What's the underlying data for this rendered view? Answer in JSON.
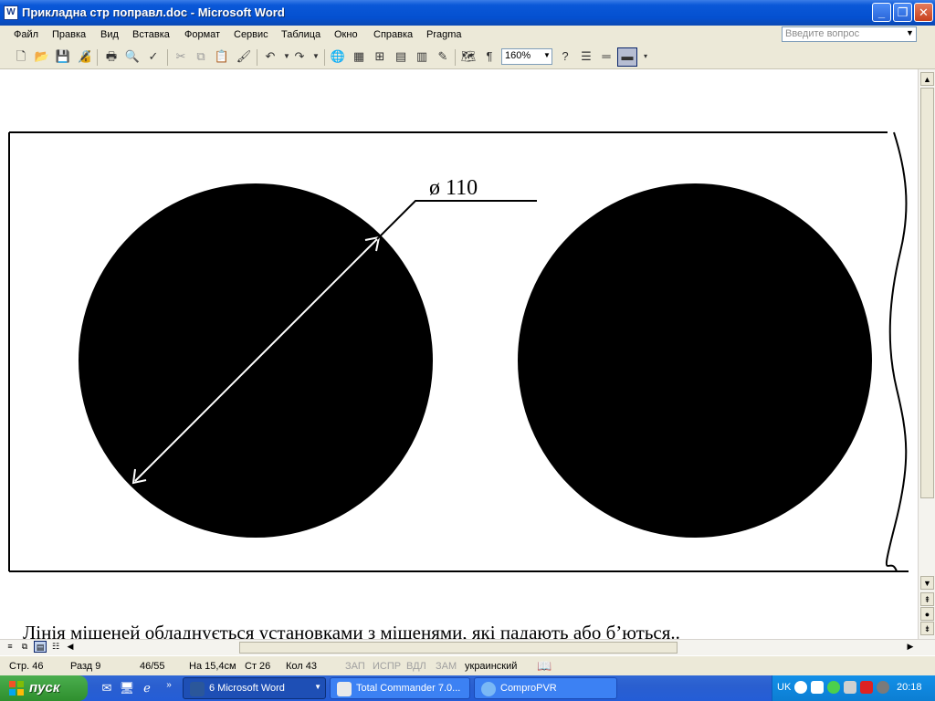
{
  "window": {
    "title": "Прикладна стр поправл.doc - Microsoft Word",
    "app_icon_label": "W"
  },
  "menu": [
    "Файл",
    "Правка",
    "Вид",
    "Вставка",
    "Формат",
    "Сервис",
    "Таблица",
    "Окно",
    "Справка",
    "Pragma"
  ],
  "help_box": {
    "placeholder": "Введите вопрос"
  },
  "toolbar": {
    "zoom": "160%"
  },
  "drawing": {
    "diameter_label": "ø 110"
  },
  "document": {
    "text": "Лінія мішеней обладнується установками з мішенями, які падають або б’ються.."
  },
  "statusbar": {
    "page": "Стр. 46",
    "section": "Разд 9",
    "pages": "46/55",
    "at": "На 15,4см",
    "line": "Ст 26",
    "col": "Кол 43",
    "rec": "ЗАП",
    "trk": "ИСПР",
    "ext": "ВДЛ",
    "ovr": "ЗАМ",
    "language": "украинский"
  },
  "taskbar": {
    "start": "пуск",
    "tasks": [
      {
        "label": "6 Microsoft Word"
      },
      {
        "label": "Total Commander 7.0..."
      },
      {
        "label": "ComproPVR"
      }
    ],
    "lang": "UK",
    "clock": "20:18"
  }
}
